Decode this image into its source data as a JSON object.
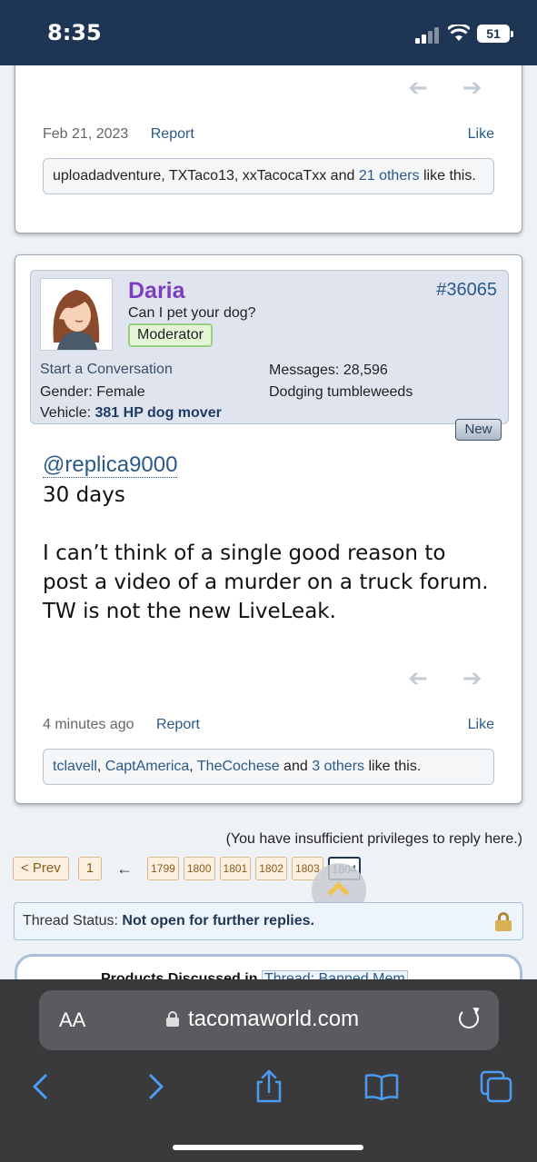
{
  "status_bar": {
    "time": "8:35",
    "battery": "51"
  },
  "post1": {
    "date": "Feb 21, 2023",
    "report": "Report",
    "like": "Like",
    "likes_users": [
      "uploadadventure",
      "TXTaco13",
      "xxTacocaTxx"
    ],
    "likes_others": "21 others",
    "likes_suffix": "like this."
  },
  "post2": {
    "author_name": "Daria",
    "post_number": "#36065",
    "author_title": "Can I pet your dog?",
    "badge": "Moderator",
    "start_conversation": "Start a Conversation",
    "gender_label": "Gender:",
    "gender_value": "Female",
    "vehicle_label": "Vehicle:",
    "vehicle_value": "381 HP dog mover",
    "messages_label": "Messages:",
    "messages_value": "28,596",
    "location": "Dodging tumbleweeds",
    "new_badge": "New",
    "mention": "@replica9000",
    "body_line1": "30 days",
    "body_line2": "I can’t think of a single good reason to post a video of a murder on a truck forum. TW is not the new LiveLeak.",
    "time": "4 minutes ago",
    "report": "Report",
    "like": "Like",
    "likes_users": [
      "tclavell",
      "CaptAmerica",
      "TheCochese"
    ],
    "likes_others": "3 others",
    "likes_suffix": "like this."
  },
  "privileges_note": "(You have insufficient privileges to reply here.)",
  "pagination": {
    "prev": "< Prev",
    "first": "1",
    "ellipsis_arrow": "←",
    "pages": [
      "1799",
      "1800",
      "1801",
      "1802",
      "1803"
    ],
    "current": "1804"
  },
  "thread_status": {
    "label": "Thread Status:",
    "value": "Not open for further replies."
  },
  "products": {
    "label": "Products Discussed in",
    "link": "Thread: Banned Mem"
  },
  "browser": {
    "aa": "AA",
    "url": "tacomaworld.com"
  },
  "icons": [
    "prev-post-arrow-icon",
    "next-post-arrow-icon",
    "lock-icon",
    "reload-icon",
    "back-icon",
    "forward-icon",
    "share-icon",
    "bookmarks-icon",
    "tabs-icon"
  ]
}
